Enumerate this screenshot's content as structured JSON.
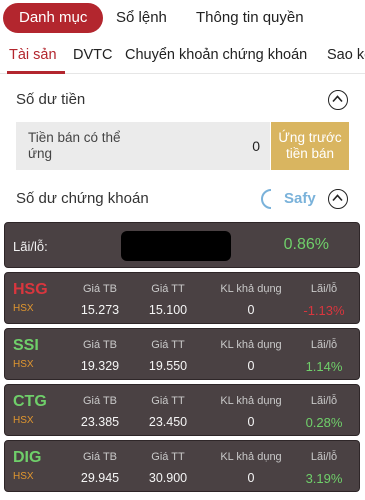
{
  "top_tabs": [
    "Danh mục",
    "Sổ lệnh",
    "Thông tin quyền"
  ],
  "sub_tabs": [
    "Tài sản",
    "DVTC",
    "Chuyển khoản chứng khoán",
    "Sao kê"
  ],
  "cash_section": {
    "title": "Số dư tiền",
    "label": "Tiền bán có thể ứng",
    "value": "0",
    "advance_button": "Ứng trước tiền bán"
  },
  "securities_section": {
    "title": "Số dư chứng khoán",
    "safy_label": "Safy"
  },
  "summary": {
    "label": "Lãi/lỗ:",
    "value": "0.86%"
  },
  "column_headers": {
    "avg_price": "Giá TB",
    "market_price": "Giá TT",
    "available_qty": "KL khả dụng",
    "pnl": "Lãi/lỗ"
  },
  "holdings": [
    {
      "symbol": "HSG",
      "exchange": "HSX",
      "avg_price": "15.273",
      "market_price": "15.100",
      "available_qty": "0",
      "pnl": "-1.13%",
      "color": "#d9363e"
    },
    {
      "symbol": "SSI",
      "exchange": "HSX",
      "avg_price": "19.329",
      "market_price": "19.550",
      "available_qty": "0",
      "pnl": "1.14%",
      "color": "#6fcf6a"
    },
    {
      "symbol": "CTG",
      "exchange": "HSX",
      "avg_price": "23.385",
      "market_price": "23.450",
      "available_qty": "0",
      "pnl": "0.28%",
      "color": "#6fcf6a"
    },
    {
      "symbol": "DIG",
      "exchange": "HSX",
      "avg_price": "29.945",
      "market_price": "30.900",
      "available_qty": "0",
      "pnl": "3.19%",
      "color": "#6fcf6a"
    }
  ],
  "colors": {
    "accent": "#b3262e",
    "gain": "#6fcf6a",
    "loss": "#d9363e",
    "advance_button": "#d9b560",
    "card_bg": "#4a4143",
    "exchange_label": "#e0962f",
    "safy": "#7ab2da"
  }
}
